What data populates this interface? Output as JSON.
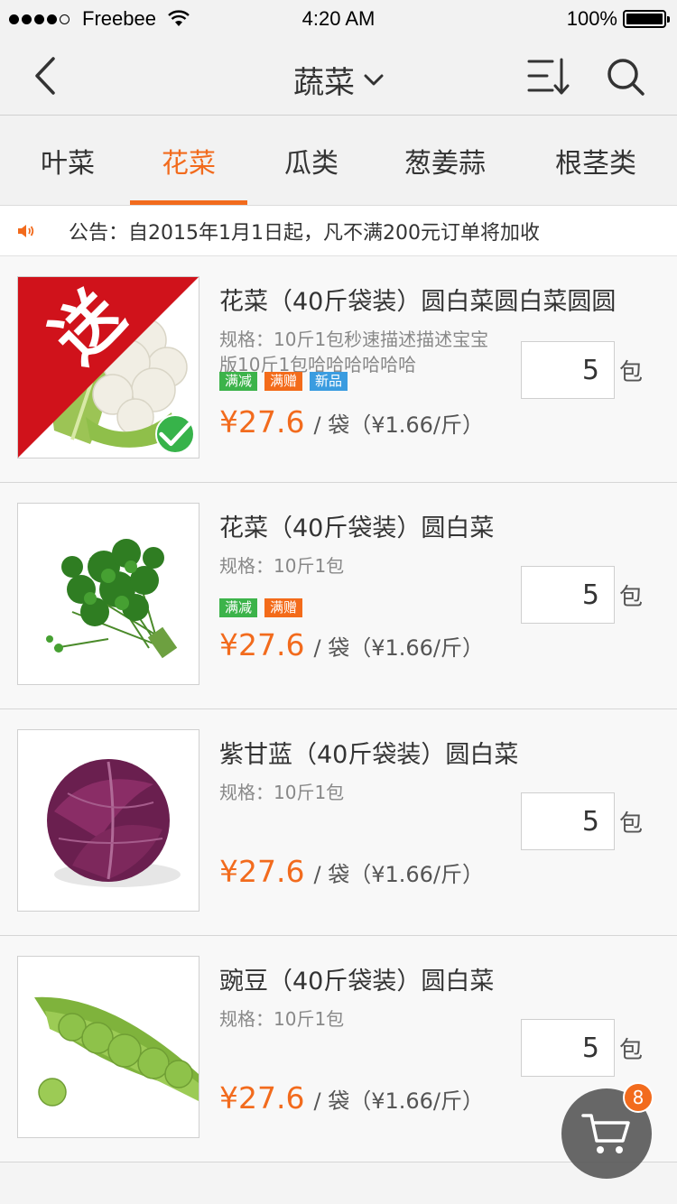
{
  "status_bar": {
    "carrier": "Freebee",
    "time": "4:20 AM",
    "battery": "100%",
    "battery_level": 1.0
  },
  "nav": {
    "title": "蔬菜",
    "back_icon": "chevron-left-icon",
    "title_icon": "chevron-down-icon",
    "sort_icon": "sort-icon",
    "search_icon": "search-icon"
  },
  "tabs": [
    {
      "label": "叶菜",
      "active": false
    },
    {
      "label": "花菜",
      "active": true
    },
    {
      "label": "瓜类",
      "active": false
    },
    {
      "label": "葱姜蒜",
      "active": false
    },
    {
      "label": "根茎类",
      "active": false
    }
  ],
  "notice": {
    "icon": "speaker-icon",
    "text": "公告：自2015年1月1日起，凡不满200元订单将加收"
  },
  "products": [
    {
      "name": "花菜（40斤袋装）圆白菜圆白菜圆圆",
      "spec": "规格：10斤1包秒速描述描述宝宝版10斤1包哈哈哈哈哈哈",
      "tags": [
        {
          "label": "满减",
          "color": "#3cb34a"
        },
        {
          "label": "满赠",
          "color": "#f36b1a"
        },
        {
          "label": "新品",
          "color": "#3a9ce0"
        }
      ],
      "price": "¥27.6",
      "unit": "/ 袋（¥1.66/斤）",
      "qty": "5",
      "qty_unit": "包",
      "ribbon": "送",
      "selected": true,
      "image": "cauliflower"
    },
    {
      "name": "花菜（40斤袋装）圆白菜",
      "spec": "规格：10斤1包",
      "tags": [
        {
          "label": "满减",
          "color": "#3cb34a"
        },
        {
          "label": "满赠",
          "color": "#f36b1a"
        }
      ],
      "price": "¥27.6",
      "unit": "/ 袋（¥1.66/斤）",
      "qty": "5",
      "qty_unit": "包",
      "image": "parsley"
    },
    {
      "name": "紫甘蓝（40斤袋装）圆白菜",
      "spec": "规格：10斤1包",
      "tags": [],
      "price": "¥27.6",
      "unit": "/ 袋（¥1.66/斤）",
      "qty": "5",
      "qty_unit": "包",
      "image": "red-cabbage"
    },
    {
      "name": "豌豆（40斤袋装）圆白菜",
      "spec": "规格：10斤1包",
      "tags": [],
      "price": "¥27.6",
      "unit": "/ 袋（¥1.66/斤）",
      "qty": "5",
      "qty_unit": "包",
      "image": "peas"
    }
  ],
  "cart": {
    "icon": "cart-icon",
    "badge": "8"
  },
  "colors": {
    "accent": "#f26b1d",
    "tag_green": "#3cb34a",
    "tag_orange": "#f36b1a",
    "tag_blue": "#3a9ce0"
  }
}
